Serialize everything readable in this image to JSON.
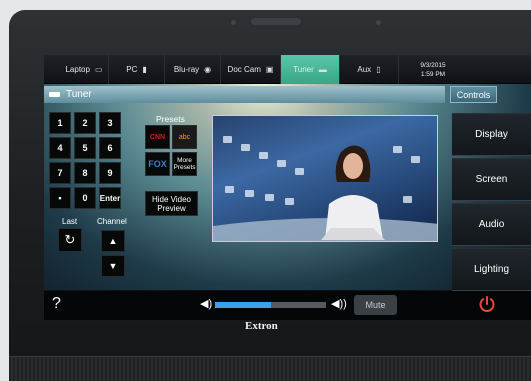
{
  "sources": [
    {
      "label": "Laptop",
      "icon": "laptop-icon",
      "glyph": "▭"
    },
    {
      "label": "PC",
      "icon": "pc-tower-icon",
      "glyph": "▮"
    },
    {
      "label": "Blu-ray",
      "icon": "disc-icon",
      "glyph": "◉"
    },
    {
      "label": "Doc Cam",
      "icon": "document-camera-icon",
      "glyph": "▣"
    },
    {
      "label": "Tuner",
      "icon": "tuner-icon",
      "glyph": "▬",
      "active": true
    },
    {
      "label": "Aux",
      "icon": "aux-device-icon",
      "glyph": "▯"
    }
  ],
  "datetime": {
    "date": "9/3/2015",
    "time": "1:59 PM"
  },
  "title": "Tuner",
  "controls_tab": "Controls",
  "keypad": [
    "1",
    "2",
    "3",
    "4",
    "5",
    "6",
    "7",
    "8",
    "9",
    "•",
    "0",
    "Enter"
  ],
  "last_label": "Last",
  "channel_label": "Channel",
  "presets_label": "Presets",
  "presets": [
    {
      "label": "CNN",
      "color": "#d21e1e"
    },
    {
      "label": "abc",
      "color": "#f0a020"
    },
    {
      "label": "FOX",
      "color": "#3a7fd0"
    },
    {
      "label": "More Presets",
      "color": "#ffffff"
    }
  ],
  "hide_video": "Hide Video Preview",
  "side_buttons": [
    "Display",
    "Screen",
    "Audio",
    "Lighting"
  ],
  "help": "?",
  "volume_level": 0.5,
  "mute": "Mute",
  "brand": "Extron",
  "colors": {
    "accent": "#39a685",
    "volume": "#3aa0e8",
    "power": "#e84a3a"
  }
}
